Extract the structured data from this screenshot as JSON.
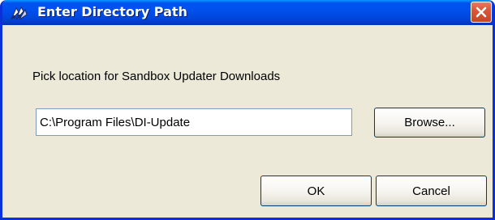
{
  "window": {
    "title": "Enter Directory Path",
    "title_icon": "sandbox-app-icon",
    "close_icon": "close-icon",
    "titlebar_color": "#0054e3",
    "close_button_color": "#d9573a"
  },
  "dialog": {
    "prompt": "Pick location for Sandbox Updater Downloads",
    "path_value": "C:\\Program Files\\DI-Update",
    "browse_label": "Browse...",
    "ok_label": "OK",
    "cancel_label": "Cancel",
    "background_color": "#ece9d8"
  }
}
